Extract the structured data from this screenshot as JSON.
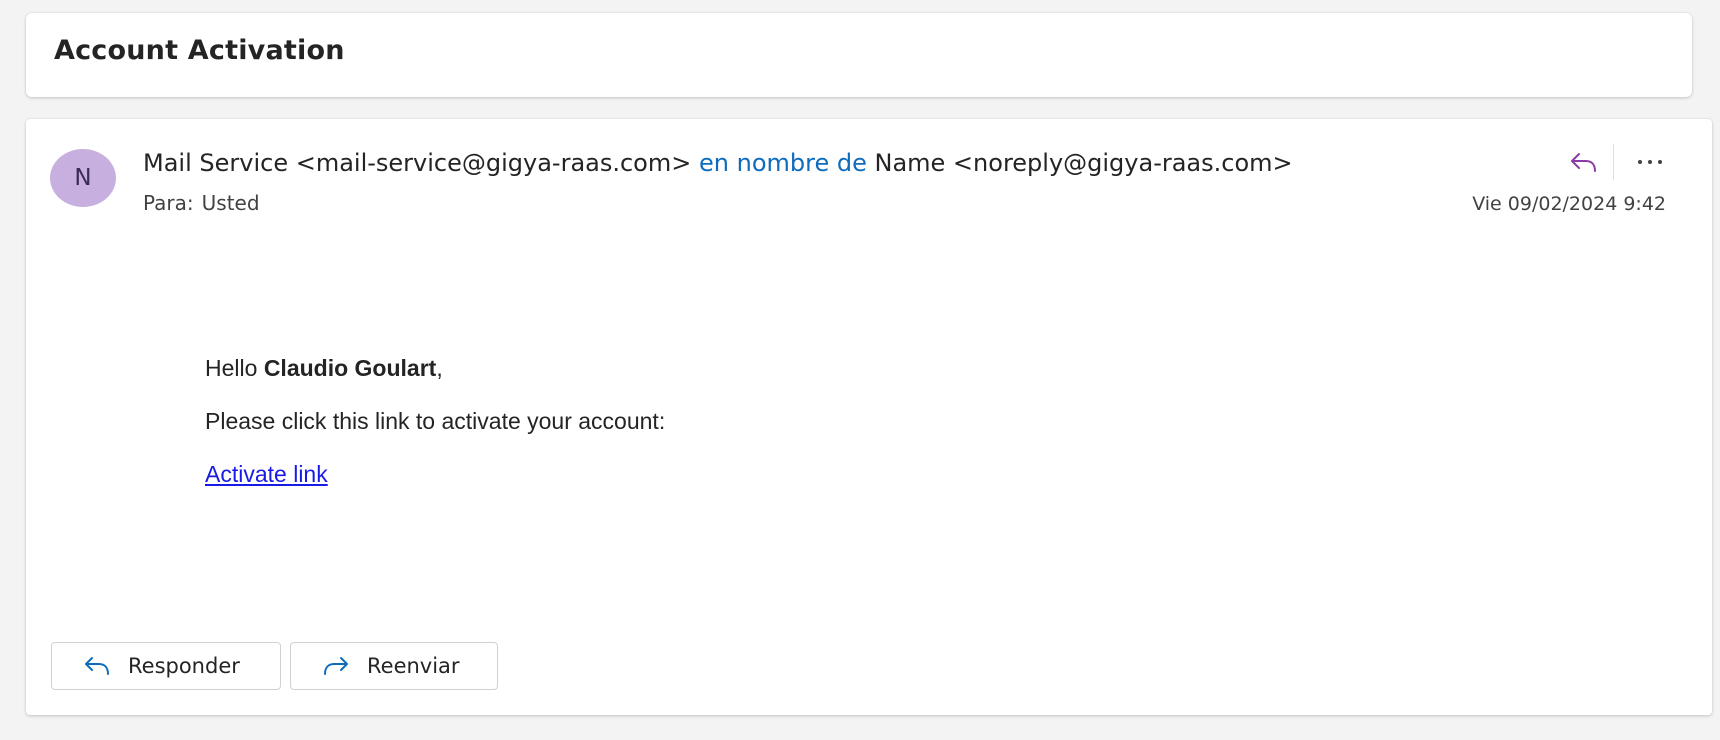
{
  "subject": "Account Activation",
  "sender": {
    "avatar_initial": "N",
    "from_name": "Mail Service <mail-service@gigya-raas.com>",
    "on_behalf_text": "en nombre de",
    "behalf_name": "Name <noreply@gigya-raas.com>",
    "to_label": "Para:",
    "to_value": "Usted",
    "date": "Vie 09/02/2024 9:42"
  },
  "toolbar": {
    "reply_icon": "reply-icon",
    "more_icon": "more-icon",
    "accent_color": "#8a3ba8"
  },
  "body": {
    "greeting_prefix": "Hello ",
    "greeting_name": "Claudio Goulart",
    "greeting_suffix": ",",
    "instruction": "Please click this link to activate your account:",
    "link_text": "Activate link"
  },
  "footer": {
    "reply_label": "Responder",
    "forward_label": "Reenviar",
    "icon_color": "#0f6cbd"
  }
}
